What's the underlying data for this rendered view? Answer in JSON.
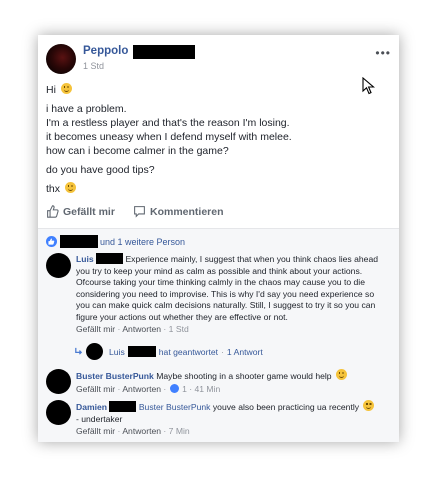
{
  "post": {
    "author": "Peppolo",
    "time": "1 Std",
    "lines": {
      "hi": "Hi",
      "l1": "i have a problem.",
      "l2": "I'm a restless player and that's the reason I'm losing.",
      "l3": "it becomes uneasy when I defend myself with melee.",
      "l4": "how can i become calmer in the game?",
      "l5": "do you have good tips?",
      "thx": "thx"
    }
  },
  "actions": {
    "like": "Gefällt mir",
    "comment": "Kommentieren"
  },
  "reactions_text": "und 1 weitere Person",
  "comments": [
    {
      "author": "Luis",
      "text": "Experience mainly, I suggest that when you think chaos lies ahead you try to keep your mind as calm as possible and think about your actions. Ofcourse taking your time thinking calmly in the chaos may cause you to die considering you need to improvise. This is why I'd say you need experience so you can make quick calm decisions naturally. Still, I suggest to try it so you can figure your actions out whether they are effective or not.",
      "like": "Gefällt mir",
      "reply": "Antworten",
      "time": "1 Std"
    },
    {
      "author": "Buster BusterPunk",
      "text": "Maybe shooting in a shooter game would help",
      "like": "Gefällt mir",
      "reply": "Antworten",
      "likes": "1",
      "time": "41 Min"
    },
    {
      "author": "Damien",
      "mention": "Buster BusterPunk",
      "text": "youve also been practicing ua recently",
      "text2": "- undertaker",
      "like": "Gefällt mir",
      "reply": "Antworten",
      "time": "7 Min"
    }
  ],
  "reply_summary": {
    "author": "Luis",
    "action": "hat geantwortet",
    "count": "1 Antwort"
  },
  "colors": {
    "link": "#365899",
    "meta": "#90949c",
    "like_badge": "#4080ff"
  }
}
